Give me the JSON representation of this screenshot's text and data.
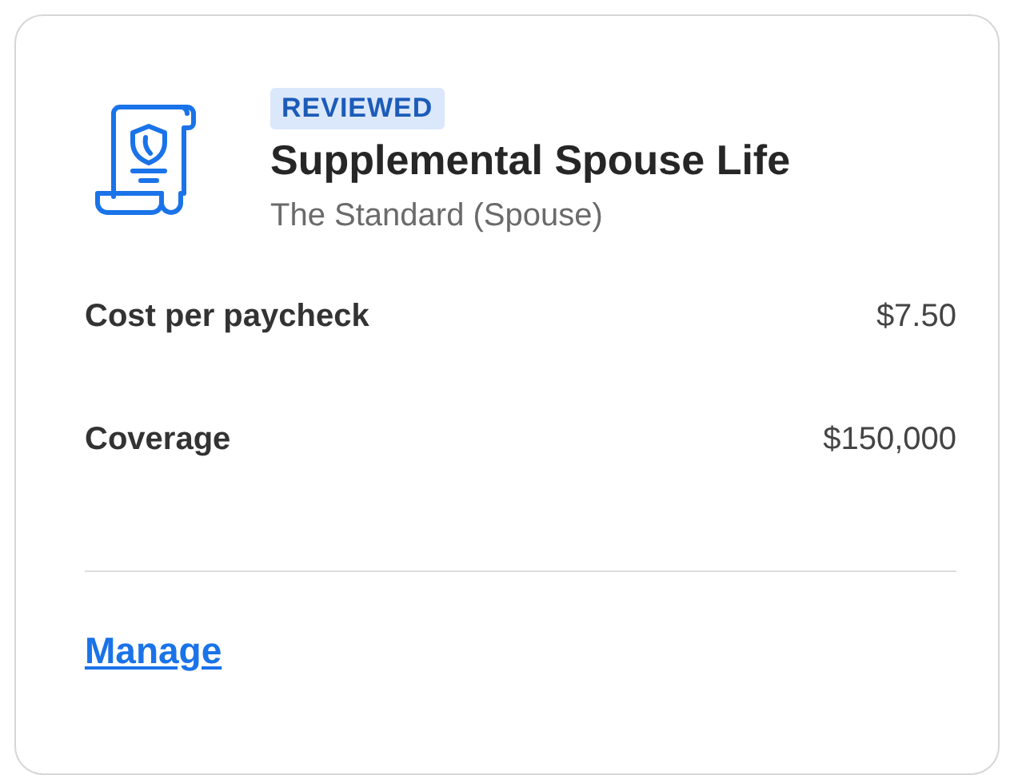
{
  "card": {
    "badge": "REVIEWED",
    "title": "Supplemental Spouse Life",
    "subtitle": "The Standard (Spouse)",
    "details": [
      {
        "label": "Cost per paycheck",
        "value": "$7.50"
      },
      {
        "label": "Coverage",
        "value": "$150,000"
      }
    ],
    "link": "Manage"
  }
}
